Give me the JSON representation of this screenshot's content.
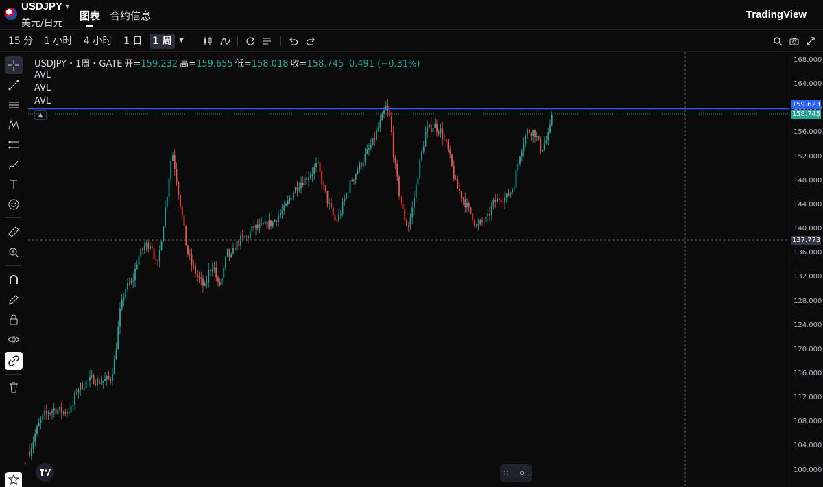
{
  "header": {
    "symbol": "USDJPY",
    "symbol_sub": "美元/日元",
    "tabs": [
      {
        "label": "图表",
        "active": true
      },
      {
        "label": "合约信息",
        "active": false
      }
    ],
    "brand": "TradingView"
  },
  "toolbar": {
    "timeframes": [
      {
        "label": "15 分"
      },
      {
        "label": "1 小时"
      },
      {
        "label": "4 小时"
      },
      {
        "label": "1 日"
      },
      {
        "label": "1 周",
        "active": true
      }
    ]
  },
  "legend": {
    "symbol_line": "USDJPY・1周・GATE",
    "open_label": "开=",
    "open": "159.232",
    "high_label": "高=",
    "high": "159.655",
    "low_label": "低=",
    "low": "158.018",
    "close_label": "收=",
    "close": "158.745",
    "change": "-0.491 (−0.31%)",
    "indicators": [
      "AVL",
      "AVL",
      "AVL"
    ]
  },
  "price_axis": {
    "ticks": [
      "168.000",
      "164.000",
      "160.000",
      "156.000",
      "152.000",
      "148.000",
      "144.000",
      "140.000",
      "136.000",
      "132.000",
      "128.000",
      "124.000",
      "120.000",
      "116.000",
      "112.000",
      "108.000",
      "104.000",
      "100.000"
    ],
    "badges": {
      "blue_line": "159.623",
      "last_price": "158.745",
      "crosshair": "137.773"
    }
  },
  "colors": {
    "background": "#0b0b0c",
    "up": "#26a69a",
    "down": "#ef5350",
    "blue_line": "#2962ff"
  },
  "chart_data": {
    "type": "candlestick",
    "interval": "1 week",
    "ylim": [
      100,
      168
    ],
    "horizontal_line": 159.623,
    "crosshair_price": 137.773,
    "close_path": [
      [
        0,
        103
      ],
      [
        12,
        107
      ],
      [
        22,
        109
      ],
      [
        36,
        110
      ],
      [
        50,
        109.5
      ],
      [
        62,
        110
      ],
      [
        68,
        113
      ],
      [
        78,
        114
      ],
      [
        92,
        115
      ],
      [
        102,
        114.5
      ],
      [
        118,
        115
      ],
      [
        124,
        118
      ],
      [
        132,
        126
      ],
      [
        140,
        130
      ],
      [
        150,
        131
      ],
      [
        158,
        135
      ],
      [
        168,
        137
      ],
      [
        178,
        137.5
      ],
      [
        186,
        133
      ],
      [
        192,
        138
      ],
      [
        200,
        145
      ],
      [
        204,
        149
      ],
      [
        208,
        153
      ],
      [
        212,
        150
      ],
      [
        220,
        144
      ],
      [
        230,
        136
      ],
      [
        240,
        133
      ],
      [
        250,
        131
      ],
      [
        256,
        130
      ],
      [
        262,
        133
      ],
      [
        268,
        134
      ],
      [
        276,
        130
      ],
      [
        282,
        132
      ],
      [
        288,
        136
      ],
      [
        294,
        135
      ],
      [
        300,
        137
      ],
      [
        308,
        138
      ],
      [
        318,
        138.5
      ],
      [
        326,
        140
      ],
      [
        336,
        140
      ],
      [
        346,
        140.5
      ],
      [
        356,
        141
      ],
      [
        362,
        142
      ],
      [
        372,
        143
      ],
      [
        380,
        145
      ],
      [
        390,
        147
      ],
      [
        400,
        148
      ],
      [
        410,
        149
      ],
      [
        420,
        150.5
      ],
      [
        428,
        147
      ],
      [
        436,
        144
      ],
      [
        446,
        141
      ],
      [
        452,
        142
      ],
      [
        460,
        145
      ],
      [
        470,
        148
      ],
      [
        480,
        150
      ],
      [
        490,
        152
      ],
      [
        500,
        154
      ],
      [
        512,
        157.5
      ],
      [
        520,
        160
      ],
      [
        526,
        158
      ],
      [
        532,
        151
      ],
      [
        540,
        145
      ],
      [
        546,
        142
      ],
      [
        552,
        140
      ],
      [
        558,
        143
      ],
      [
        568,
        150
      ],
      [
        578,
        156
      ],
      [
        590,
        157
      ],
      [
        600,
        156
      ],
      [
        610,
        153
      ],
      [
        622,
        147
      ],
      [
        632,
        145
      ],
      [
        640,
        143
      ],
      [
        646,
        142
      ],
      [
        652,
        140
      ],
      [
        660,
        141
      ],
      [
        668,
        141.5
      ],
      [
        676,
        144
      ],
      [
        686,
        145
      ],
      [
        696,
        145
      ],
      [
        706,
        147
      ],
      [
        716,
        153
      ],
      [
        726,
        156
      ],
      [
        736,
        156
      ],
      [
        746,
        153
      ],
      [
        756,
        155
      ],
      [
        764,
        158.745
      ]
    ]
  }
}
